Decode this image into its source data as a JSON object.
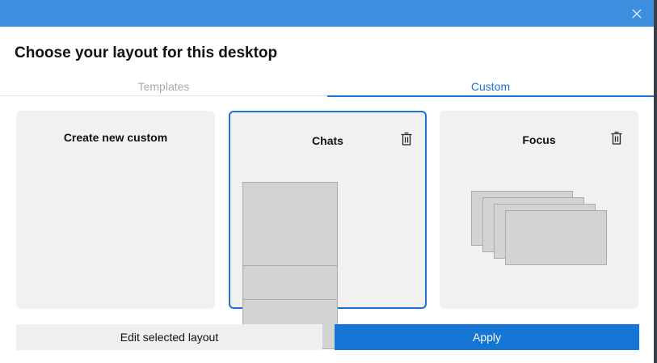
{
  "dialog": {
    "heading": "Choose your layout for this desktop",
    "close_icon": "close-icon"
  },
  "tabs": [
    {
      "label": "Templates",
      "selected": false
    },
    {
      "label": "Custom",
      "selected": true
    }
  ],
  "cards": {
    "create_new": {
      "label": "Create new custom"
    },
    "chats": {
      "label": "Chats",
      "selected": true,
      "delete_icon": "trash-icon"
    },
    "focus": {
      "label": "Focus",
      "selected": false,
      "delete_icon": "trash-icon"
    }
  },
  "buttons": {
    "edit": "Edit selected layout",
    "apply": "Apply"
  },
  "colors": {
    "titlebar": "#3c8fde",
    "accent": "#1a73d6",
    "apply_button": "#1676d6",
    "card_background": "#f1f1f1",
    "zone_fill": "#d3d3d3"
  }
}
